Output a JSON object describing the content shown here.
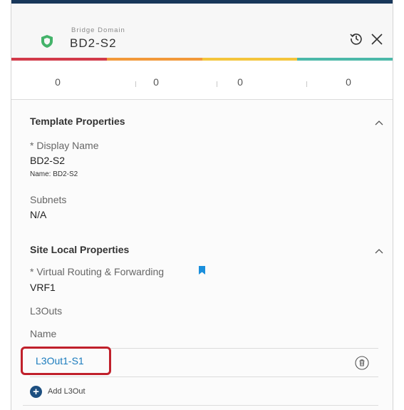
{
  "header": {
    "object_type": "Bridge Domain",
    "object_name": "BD2-S2",
    "status_colors": [
      "#d23a4a",
      "#f2993a",
      "#f4c53c",
      "#4cb8a9"
    ]
  },
  "counts": [
    "0",
    "0",
    "0",
    "0"
  ],
  "template_properties": {
    "title": "Template Properties",
    "display_name_label": "* Display Name",
    "display_name_value": "BD2-S2",
    "name_note": "Name: BD2-S2",
    "subnets_label": "Subnets",
    "subnets_value": "N/A"
  },
  "site_local_properties": {
    "title": "Site Local Properties",
    "vrf_label": "* Virtual Routing & Forwarding",
    "vrf_value": "VRF1",
    "l3outs_label": "L3Outs",
    "name_column": "Name",
    "l3outs": [
      {
        "name": "L3Out1-S1"
      }
    ],
    "add_label": "Add L3Out"
  },
  "icons": {
    "object": "shield-icon",
    "history": "history-icon",
    "close": "close-icon",
    "collapse": "chevron-up-icon",
    "bookmark": "bookmark-icon",
    "delete": "trash-icon",
    "add": "plus-circle-icon"
  }
}
